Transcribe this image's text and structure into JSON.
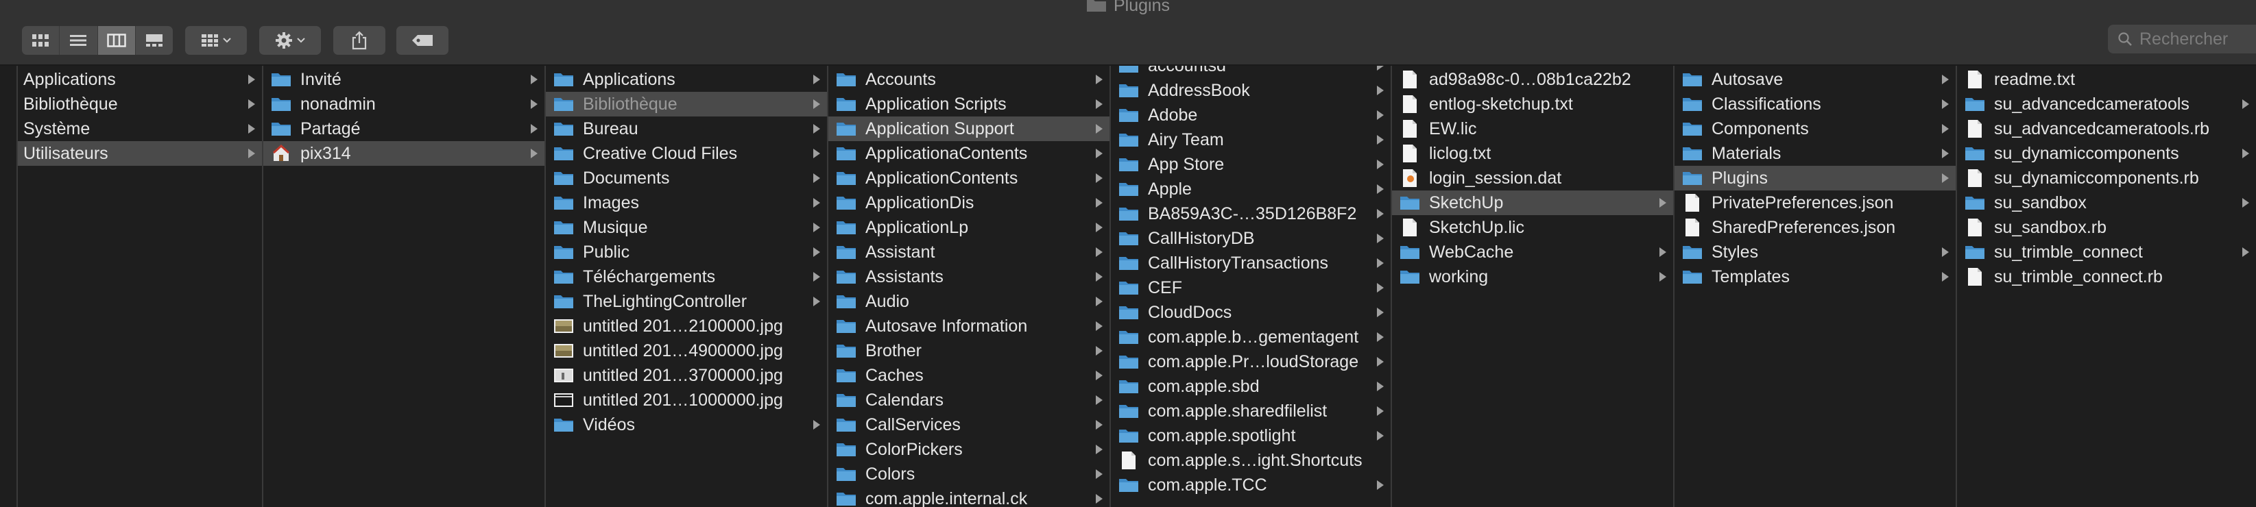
{
  "window": {
    "title": "Plugins"
  },
  "toolbar": {
    "view_buttons": [
      "icons-view",
      "list-view",
      "columns-view",
      "gallery-view"
    ],
    "active_view": "columns-view"
  },
  "search": {
    "placeholder": "Rechercher"
  },
  "columns": [
    {
      "items": [
        {
          "label": "Applications",
          "icon": "none",
          "arrow": true
        },
        {
          "label": "Bibliothèque",
          "icon": "none",
          "arrow": true
        },
        {
          "label": "Système",
          "icon": "none",
          "arrow": true
        },
        {
          "label": "Utilisateurs",
          "icon": "none",
          "arrow": true,
          "selected": true
        }
      ]
    },
    {
      "items": [
        {
          "label": "Invité",
          "icon": "folder",
          "arrow": true
        },
        {
          "label": "nonadmin",
          "icon": "folder",
          "arrow": true
        },
        {
          "label": "Partagé",
          "icon": "folder",
          "arrow": true
        },
        {
          "label": "pix314",
          "icon": "home",
          "arrow": true,
          "selected": true
        }
      ]
    },
    {
      "items": [
        {
          "label": "Applications",
          "icon": "folder",
          "arrow": true
        },
        {
          "label": "Bibliothèque",
          "icon": "folder",
          "arrow": true,
          "selected": true,
          "dim": true
        },
        {
          "label": "Bureau",
          "icon": "folder",
          "arrow": true
        },
        {
          "label": "Creative Cloud Files",
          "icon": "folder",
          "arrow": true
        },
        {
          "label": "Documents",
          "icon": "folder",
          "arrow": true
        },
        {
          "label": "Images",
          "icon": "folder",
          "arrow": true
        },
        {
          "label": "Musique",
          "icon": "folder",
          "arrow": true
        },
        {
          "label": "Public",
          "icon": "folder",
          "arrow": true
        },
        {
          "label": "Téléchargements",
          "icon": "folder",
          "arrow": true
        },
        {
          "label": "TheLightingController",
          "icon": "folder",
          "arrow": true
        },
        {
          "label": "untitled 201…2100000.jpg",
          "icon": "image",
          "arrow": false
        },
        {
          "label": "untitled 201…4900000.jpg",
          "icon": "image",
          "arrow": false
        },
        {
          "label": "untitled 201…3700000.jpg",
          "icon": "image-light",
          "arrow": false
        },
        {
          "label": "untitled 201…1000000.jpg",
          "icon": "image-dark",
          "arrow": false
        },
        {
          "label": "Vidéos",
          "icon": "folder",
          "arrow": true
        }
      ]
    },
    {
      "items": [
        {
          "label": "Accounts",
          "icon": "folder",
          "arrow": true
        },
        {
          "label": "Application Scripts",
          "icon": "folder",
          "arrow": true
        },
        {
          "label": "Application Support",
          "icon": "folder",
          "arrow": true,
          "selected": true
        },
        {
          "label": "ApplicationaContents",
          "icon": "folder",
          "arrow": true
        },
        {
          "label": "ApplicationContents",
          "icon": "folder",
          "arrow": true
        },
        {
          "label": "ApplicationDis",
          "icon": "folder",
          "arrow": true
        },
        {
          "label": "ApplicationLp",
          "icon": "folder",
          "arrow": true
        },
        {
          "label": "Assistant",
          "icon": "folder",
          "arrow": true
        },
        {
          "label": "Assistants",
          "icon": "folder",
          "arrow": true
        },
        {
          "label": "Audio",
          "icon": "folder",
          "arrow": true
        },
        {
          "label": "Autosave Information",
          "icon": "folder",
          "arrow": true
        },
        {
          "label": "Brother",
          "icon": "folder",
          "arrow": true
        },
        {
          "label": "Caches",
          "icon": "folder",
          "arrow": true
        },
        {
          "label": "Calendars",
          "icon": "folder",
          "arrow": true
        },
        {
          "label": "CallServices",
          "icon": "folder",
          "arrow": true
        },
        {
          "label": "ColorPickers",
          "icon": "folder",
          "arrow": true
        },
        {
          "label": "Colors",
          "icon": "folder",
          "arrow": true
        },
        {
          "label": "com.apple.internal.ck",
          "icon": "folder",
          "arrow": true
        }
      ]
    },
    {
      "items": [
        {
          "label": "accountsd",
          "icon": "folder",
          "arrow": true
        },
        {
          "label": "AddressBook",
          "icon": "folder",
          "arrow": true
        },
        {
          "label": "Adobe",
          "icon": "folder",
          "arrow": true
        },
        {
          "label": "Airy Team",
          "icon": "folder",
          "arrow": true
        },
        {
          "label": "App Store",
          "icon": "folder",
          "arrow": true
        },
        {
          "label": "Apple",
          "icon": "folder",
          "arrow": true
        },
        {
          "label": "BA859A3C-…35D126B8F2",
          "icon": "folder",
          "arrow": true
        },
        {
          "label": "CallHistoryDB",
          "icon": "folder",
          "arrow": true
        },
        {
          "label": "CallHistoryTransactions",
          "icon": "folder",
          "arrow": true
        },
        {
          "label": "CEF",
          "icon": "folder",
          "arrow": true
        },
        {
          "label": "CloudDocs",
          "icon": "folder",
          "arrow": true
        },
        {
          "label": "com.apple.b…gementagent",
          "icon": "folder",
          "arrow": true
        },
        {
          "label": "com.apple.Pr…loudStorage",
          "icon": "folder",
          "arrow": true
        },
        {
          "label": "com.apple.sbd",
          "icon": "folder",
          "arrow": true
        },
        {
          "label": "com.apple.sharedfilelist",
          "icon": "folder",
          "arrow": true
        },
        {
          "label": "com.apple.spotlight",
          "icon": "folder",
          "arrow": true
        },
        {
          "label": "com.apple.s…ight.Shortcuts",
          "icon": "doc",
          "arrow": false
        },
        {
          "label": "com.apple.TCC",
          "icon": "folder",
          "arrow": true
        }
      ]
    },
    {
      "items": [
        {
          "label": "ad98a98c-0…08b1ca22b2",
          "icon": "doc",
          "arrow": false
        },
        {
          "label": "entlog-sketchup.txt",
          "icon": "doc",
          "arrow": false
        },
        {
          "label": "EW.lic",
          "icon": "doc",
          "arrow": false
        },
        {
          "label": "liclog.txt",
          "icon": "doc",
          "arrow": false
        },
        {
          "label": "login_session.dat",
          "icon": "doc-dat",
          "arrow": false
        },
        {
          "label": "SketchUp",
          "icon": "folder",
          "arrow": true,
          "selected": true
        },
        {
          "label": "SketchUp.lic",
          "icon": "doc",
          "arrow": false
        },
        {
          "label": "WebCache",
          "icon": "folder",
          "arrow": true
        },
        {
          "label": "working",
          "icon": "folder",
          "arrow": true
        }
      ]
    },
    {
      "items": [
        {
          "label": "Autosave",
          "icon": "folder",
          "arrow": true
        },
        {
          "label": "Classifications",
          "icon": "folder",
          "arrow": true
        },
        {
          "label": "Components",
          "icon": "folder",
          "arrow": true
        },
        {
          "label": "Materials",
          "icon": "folder",
          "arrow": true
        },
        {
          "label": "Plugins",
          "icon": "folder",
          "arrow": true,
          "selected": true
        },
        {
          "label": "PrivatePreferences.json",
          "icon": "doc",
          "arrow": false
        },
        {
          "label": "SharedPreferences.json",
          "icon": "doc",
          "arrow": false
        },
        {
          "label": "Styles",
          "icon": "folder",
          "arrow": true
        },
        {
          "label": "Templates",
          "icon": "folder",
          "arrow": true
        }
      ]
    },
    {
      "items": [
        {
          "label": "readme.txt",
          "icon": "doc",
          "arrow": false
        },
        {
          "label": "su_advancedcameratools",
          "icon": "folder",
          "arrow": true
        },
        {
          "label": "su_advancedcameratools.rb",
          "icon": "doc",
          "arrow": false
        },
        {
          "label": "su_dynamiccomponents",
          "icon": "folder",
          "arrow": true
        },
        {
          "label": "su_dynamiccomponents.rb",
          "icon": "doc",
          "arrow": false
        },
        {
          "label": "su_sandbox",
          "icon": "folder",
          "arrow": true
        },
        {
          "label": "su_sandbox.rb",
          "icon": "doc",
          "arrow": false
        },
        {
          "label": "su_trimble_connect",
          "icon": "folder",
          "arrow": true
        },
        {
          "label": "su_trimble_connect.rb",
          "icon": "doc",
          "arrow": false
        }
      ]
    }
  ],
  "colors": {
    "folder": "#5aa5dc",
    "selection": "#4a4a4a",
    "background": "#1e1e1e"
  }
}
